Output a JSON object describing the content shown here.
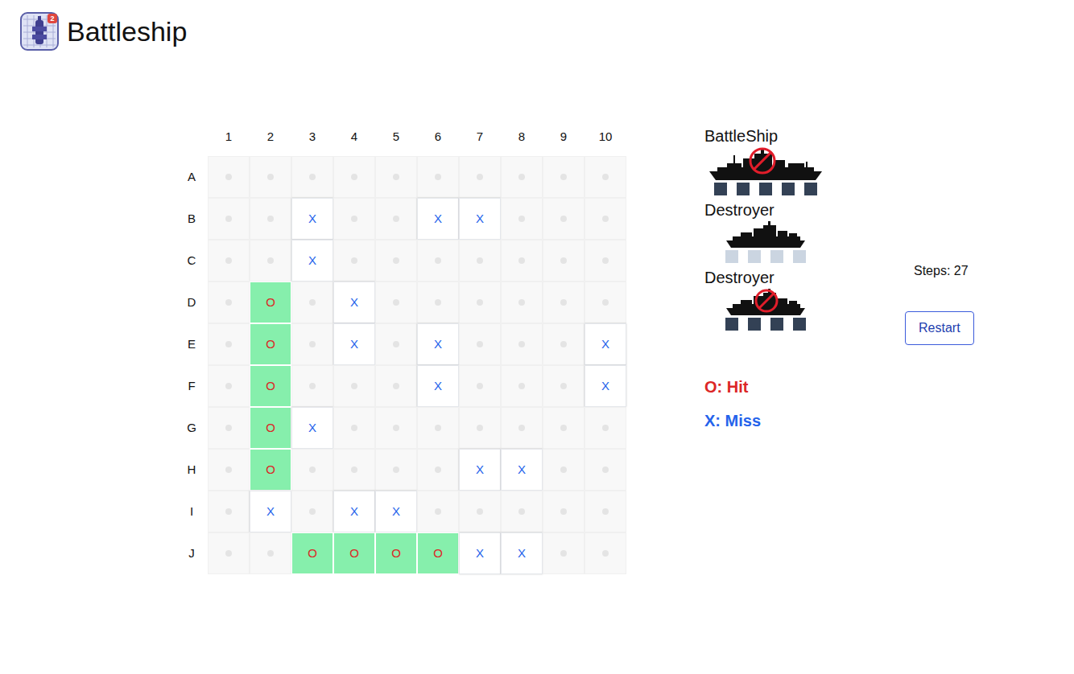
{
  "title": "Battleship",
  "logo_badge": "2",
  "board": {
    "columns": [
      "1",
      "2",
      "3",
      "4",
      "5",
      "6",
      "7",
      "8",
      "9",
      "10"
    ],
    "rows": [
      {
        "label": "A",
        "cells": [
          {
            "kind": "empty"
          },
          {
            "kind": "empty"
          },
          {
            "kind": "empty"
          },
          {
            "kind": "empty"
          },
          {
            "kind": "empty"
          },
          {
            "kind": "empty"
          },
          {
            "kind": "empty"
          },
          {
            "kind": "empty"
          },
          {
            "kind": "empty"
          },
          {
            "kind": "empty"
          }
        ]
      },
      {
        "label": "B",
        "cells": [
          {
            "kind": "empty"
          },
          {
            "kind": "empty"
          },
          {
            "kind": "miss",
            "text": "X"
          },
          {
            "kind": "empty"
          },
          {
            "kind": "empty"
          },
          {
            "kind": "miss",
            "text": "X"
          },
          {
            "kind": "miss",
            "text": "X"
          },
          {
            "kind": "empty"
          },
          {
            "kind": "empty"
          },
          {
            "kind": "empty"
          }
        ]
      },
      {
        "label": "C",
        "cells": [
          {
            "kind": "empty"
          },
          {
            "kind": "empty"
          },
          {
            "kind": "miss",
            "text": "X"
          },
          {
            "kind": "empty"
          },
          {
            "kind": "empty"
          },
          {
            "kind": "empty"
          },
          {
            "kind": "empty"
          },
          {
            "kind": "empty"
          },
          {
            "kind": "empty"
          },
          {
            "kind": "empty"
          }
        ]
      },
      {
        "label": "D",
        "cells": [
          {
            "kind": "empty"
          },
          {
            "kind": "hit",
            "text": "O"
          },
          {
            "kind": "empty"
          },
          {
            "kind": "miss",
            "text": "X"
          },
          {
            "kind": "empty"
          },
          {
            "kind": "empty"
          },
          {
            "kind": "empty"
          },
          {
            "kind": "empty"
          },
          {
            "kind": "empty"
          },
          {
            "kind": "empty"
          }
        ]
      },
      {
        "label": "E",
        "cells": [
          {
            "kind": "empty"
          },
          {
            "kind": "hit",
            "text": "O"
          },
          {
            "kind": "empty"
          },
          {
            "kind": "miss",
            "text": "X"
          },
          {
            "kind": "empty"
          },
          {
            "kind": "miss",
            "text": "X"
          },
          {
            "kind": "empty"
          },
          {
            "kind": "empty"
          },
          {
            "kind": "empty"
          },
          {
            "kind": "miss",
            "text": "X"
          }
        ]
      },
      {
        "label": "F",
        "cells": [
          {
            "kind": "empty"
          },
          {
            "kind": "hit",
            "text": "O"
          },
          {
            "kind": "empty"
          },
          {
            "kind": "empty"
          },
          {
            "kind": "empty"
          },
          {
            "kind": "miss",
            "text": "X"
          },
          {
            "kind": "empty"
          },
          {
            "kind": "empty"
          },
          {
            "kind": "empty"
          },
          {
            "kind": "miss",
            "text": "X"
          }
        ]
      },
      {
        "label": "G",
        "cells": [
          {
            "kind": "empty"
          },
          {
            "kind": "hit",
            "text": "O"
          },
          {
            "kind": "miss",
            "text": "X"
          },
          {
            "kind": "empty"
          },
          {
            "kind": "empty"
          },
          {
            "kind": "empty"
          },
          {
            "kind": "empty"
          },
          {
            "kind": "empty"
          },
          {
            "kind": "empty"
          },
          {
            "kind": "empty"
          }
        ]
      },
      {
        "label": "H",
        "cells": [
          {
            "kind": "empty"
          },
          {
            "kind": "hit",
            "text": "O"
          },
          {
            "kind": "empty"
          },
          {
            "kind": "empty"
          },
          {
            "kind": "empty"
          },
          {
            "kind": "empty"
          },
          {
            "kind": "miss",
            "text": "X"
          },
          {
            "kind": "miss",
            "text": "X"
          },
          {
            "kind": "empty"
          },
          {
            "kind": "empty"
          }
        ]
      },
      {
        "label": "I",
        "cells": [
          {
            "kind": "empty"
          },
          {
            "kind": "miss",
            "text": "X"
          },
          {
            "kind": "empty"
          },
          {
            "kind": "miss",
            "text": "X"
          },
          {
            "kind": "miss",
            "text": "X"
          },
          {
            "kind": "empty"
          },
          {
            "kind": "empty"
          },
          {
            "kind": "empty"
          },
          {
            "kind": "empty"
          },
          {
            "kind": "empty"
          }
        ]
      },
      {
        "label": "J",
        "cells": [
          {
            "kind": "empty"
          },
          {
            "kind": "empty"
          },
          {
            "kind": "hit",
            "text": "O"
          },
          {
            "kind": "hit",
            "text": "O"
          },
          {
            "kind": "hit",
            "text": "O"
          },
          {
            "kind": "hit",
            "text": "O"
          },
          {
            "kind": "miss",
            "text": "X"
          },
          {
            "kind": "miss",
            "text": "X"
          },
          {
            "kind": "empty"
          },
          {
            "kind": "empty"
          }
        ]
      }
    ]
  },
  "ships": [
    {
      "name": "BattleShip",
      "kind": "battleship",
      "sunk": true,
      "size": 5
    },
    {
      "name": "Destroyer",
      "kind": "destroyer",
      "sunk": false,
      "size": 4
    },
    {
      "name": "Destroyer",
      "kind": "destroyer",
      "sunk": true,
      "size": 4
    }
  ],
  "steps": "Steps: 27",
  "restart_button": "Restart",
  "legend": [
    {
      "text": "O: Hit",
      "color": "#dc2626"
    },
    {
      "text": "X: Miss",
      "color": "#2563eb"
    }
  ]
}
